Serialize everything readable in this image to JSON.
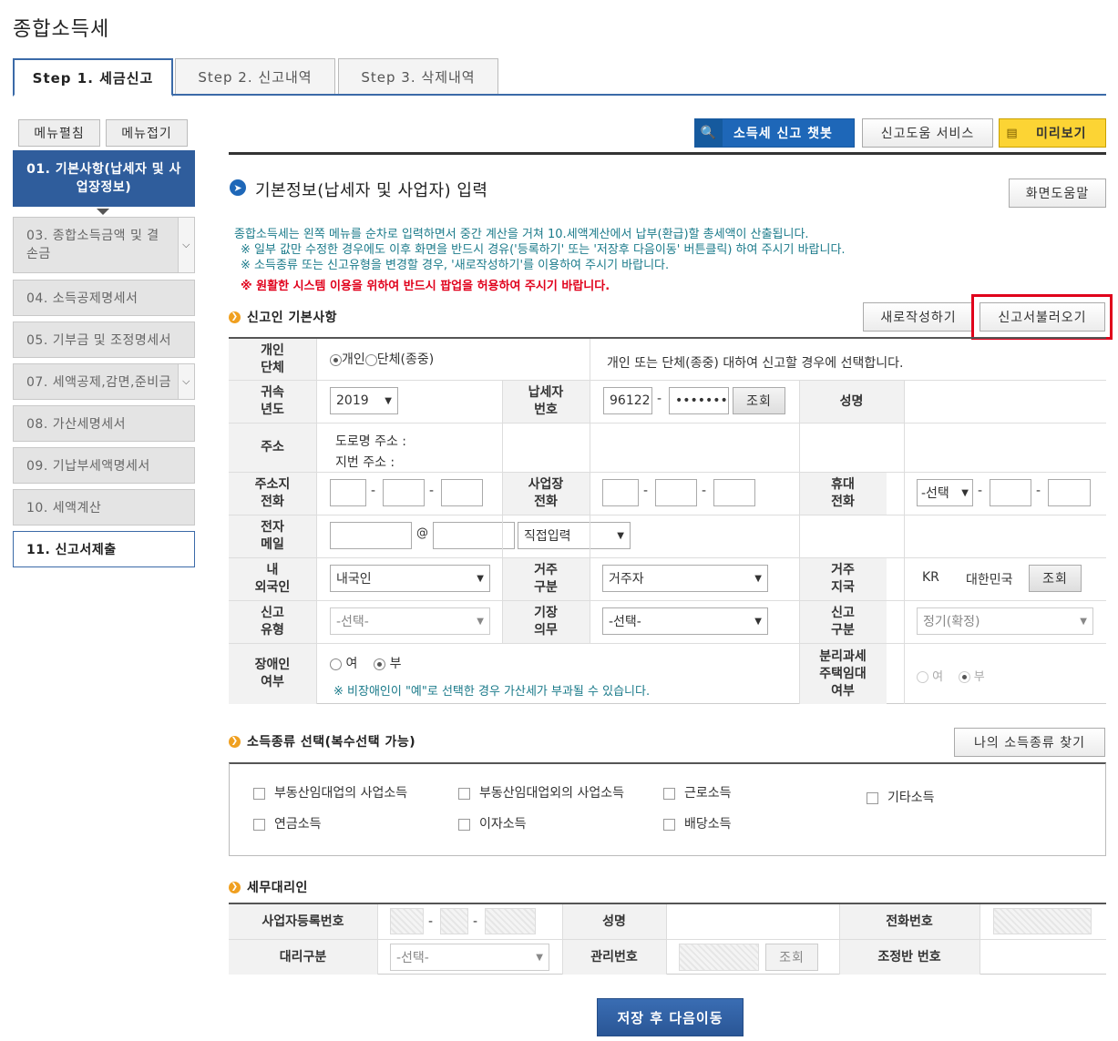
{
  "page_title": "종합소득세",
  "tabs": [
    "Step 1. 세금신고",
    "Step 2. 신고내역",
    "Step 3. 삭제내역"
  ],
  "sidebar": {
    "expand": "메뉴펼침",
    "collapse": "메뉴접기",
    "items": [
      {
        "label": "01. 기본사항(납세자 및 사업장정보)"
      },
      {
        "label": "03. 종합소득금액 및 결손금"
      },
      {
        "label": "04. 소득공제명세서"
      },
      {
        "label": "05. 기부금 및 조정명세서"
      },
      {
        "label": "07. 세액공제,감면,준비금"
      },
      {
        "label": "08. 가산세명세서"
      },
      {
        "label": "09. 기납부세액명세서"
      },
      {
        "label": "10. 세액계산"
      },
      {
        "label": "11. 신고서제출"
      }
    ]
  },
  "top_buttons": {
    "chatbot": "소득세 신고 챗봇",
    "help_service": "신고도움 서비스",
    "preview": "미리보기"
  },
  "main": {
    "heading": "기본정보(납세자 및 사업자) 입력",
    "screen_help": "화면도움말",
    "notice1": "종합소득세는 왼쪽 메뉴를 순차로 입력하면서 중간 계산을 거쳐 10.세액계산에서 납부(환급)할 총세액이 산출됩니다.",
    "notice2": "※ 일부 값만 수정한 경우에도 이후 화면을 반드시 경유('등록하기' 또는 '저장후 다음이동' 버튼클릭) 하여 주시기 바랍니다.",
    "notice3": "※ 소득종류 또는 신고유형을 변경할 경우, '새로작성하기'를 이용하여 주시기 바랍니다.",
    "notice_red": "※ 원활한 시스템 이용을 위하여 반드시 팝업을 허용하여 주시기 바랍니다."
  },
  "basic": {
    "title": "신고인 기본사항",
    "new_btn": "새로작성하기",
    "load_btn": "신고서불러오기",
    "individual_label": "개인\n단체",
    "opt_individual": "개인",
    "opt_group": "단체(종중)",
    "individual_desc": "개인 또는 단체(종중) 대하여 신고할 경우에 선택합니다.",
    "year_label": "귀속\n년도",
    "year_value": "2019",
    "taxpayer_label": "납세자\n번호",
    "taxpayer_front": "96122",
    "taxpayer_back": "•••••••",
    "lookup": "조회",
    "name_label": "성명",
    "address_label": "주소",
    "road_addr": "도로명 주소 :",
    "lot_addr": "지번 주소 :",
    "home_phone_label": "주소지\n전화",
    "biz_phone_label": "사업장\n전화",
    "mobile_label": "휴대\n전화",
    "mobile_select": "-선택",
    "email_label": "전자\n메일",
    "at": "@",
    "email_select": "직접입력",
    "foreign_label": "내\n외국인",
    "foreign_value": "내국인",
    "resident_label": "거주\n구분",
    "resident_value": "거주자",
    "country_label": "거주\n지국",
    "country_code": "KR",
    "country_name": "대한민국",
    "report_type_label": "신고\n유형",
    "report_type_value": "-선택-",
    "bookkeeping_label": "기장\n의무",
    "bookkeeping_value": "-선택-",
    "report_class_label": "신고\n구분",
    "report_class_value": "정기(확정)",
    "disabled_label": "장애인\n여부",
    "yes": "여",
    "no": "부",
    "disabled_note": "※ 비장애인이 \"예\"로 선택한 경우 가산세가 부과될 수 있습니다.",
    "rental_label": "분리과세\n주택임대\n여부"
  },
  "income": {
    "title": "소득종류 선택(복수선택 가능)",
    "find_btn": "나의 소득종류 찾기",
    "types": [
      "부동산임대업의 사업소득",
      "부동산임대업외의 사업소득",
      "근로소득",
      "기타소득",
      "연금소득",
      "이자소득",
      "배당소득"
    ]
  },
  "agent": {
    "title": "세무대리인",
    "biz_no_label": "사업자등록번호",
    "name_label": "성명",
    "phone_label": "전화번호",
    "type_label": "대리구분",
    "type_value": "-선택-",
    "mgmt_label": "관리번호",
    "lookup": "조회",
    "team_label": "조정반 번호"
  },
  "save_next": "저장 후 다음이동",
  "colors": {
    "accent_blue": "#2f5d9c",
    "highlight_red": "#e0001b",
    "notice_teal": "#1a7a8a"
  }
}
